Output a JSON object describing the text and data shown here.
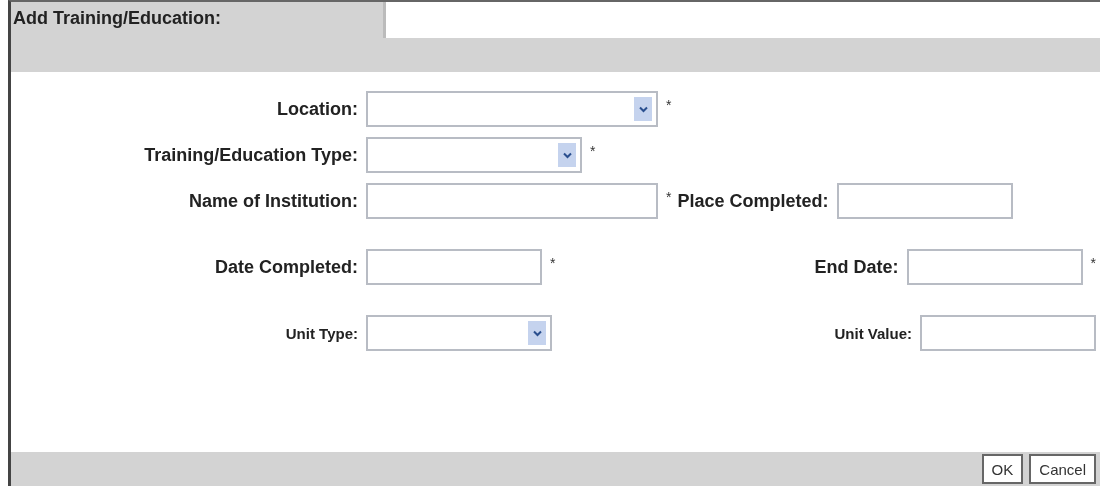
{
  "title": "Add Training/Education:",
  "rows": [
    [
      {
        "label": "Location:",
        "kind": "select",
        "mark": "*"
      }
    ],
    [
      {
        "label": "Training/Education Type:",
        "kind": "select",
        "mark": "*"
      }
    ],
    [
      {
        "label": "Name of Institution:",
        "kind": "text",
        "mark": "*"
      },
      {
        "label": "Place Completed:",
        "kind": "text"
      }
    ],
    [
      {
        "label": "Date Completed:",
        "kind": "text",
        "mark": "*"
      },
      {
        "label": "End Date:",
        "kind": "text",
        "mark": "*"
      }
    ],
    [
      {
        "label": "Unit Type:",
        "kind": "select"
      },
      {
        "label": "Unit Value:",
        "kind": "text"
      }
    ]
  ],
  "buttons": [
    "OK",
    "Cancel"
  ]
}
